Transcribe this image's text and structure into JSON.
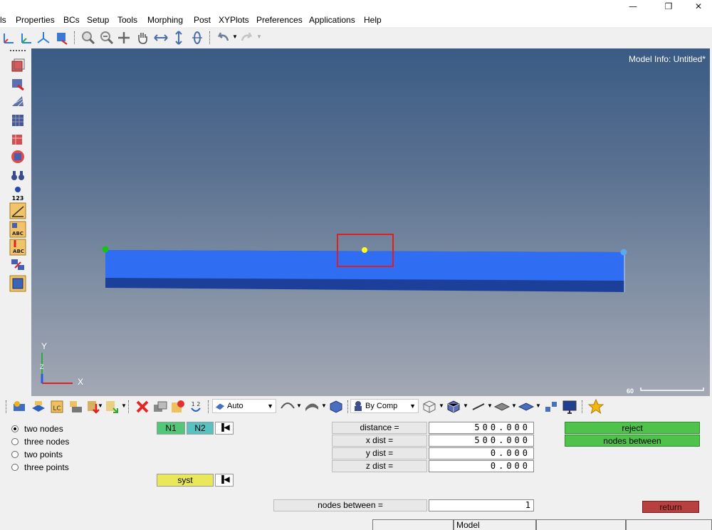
{
  "window": {
    "minimize": "—",
    "restore": "❐",
    "close": "✕"
  },
  "menu": [
    "ls",
    "Properties",
    "BCs",
    "Setup",
    "Tools",
    "Morphing",
    "Post",
    "XYPlots",
    "Preferences",
    "Applications",
    "Help"
  ],
  "viewport": {
    "model_info": "Model Info: Untitled*",
    "scale_label": "60",
    "axis_y": "Y",
    "axis_x": "X",
    "axis_z": "Z"
  },
  "bottom_toolbar": {
    "auto_combo": "Auto",
    "bycomp_combo": "By Comp"
  },
  "panel": {
    "radios": [
      {
        "label": "two nodes",
        "selected": true
      },
      {
        "label": "three nodes",
        "selected": false
      },
      {
        "label": "two points",
        "selected": false
      },
      {
        "label": "three points",
        "selected": false
      }
    ],
    "n1": "N1",
    "n2": "N2",
    "syst": "syst",
    "reset_glyph": "▐◀",
    "distance_label": "distance =",
    "distance_value": "500.000",
    "xdist_label": "x dist  =",
    "xdist_value": "500.000",
    "ydist_label": "y dist  =",
    "ydist_value": "0.000",
    "zdist_label": "z dist  =",
    "zdist_value": "0.000",
    "nodes_between_label": "nodes between  =",
    "nodes_between_value": "1",
    "reject": "reject",
    "nodes_between_btn": "nodes between",
    "return": "return"
  },
  "status": {
    "model": "Model"
  },
  "colors": {
    "beam_top": "#2f6ef2",
    "beam_side": "#1c3f9a",
    "selection_box": "#e02020",
    "node_green": "#19c219",
    "node_yellow": "#ffff20",
    "node_blue": "#5aaaf0",
    "n1_bg": "#50c878",
    "n2_bg": "#56c2c2",
    "syst_bg": "#e8e85a"
  }
}
